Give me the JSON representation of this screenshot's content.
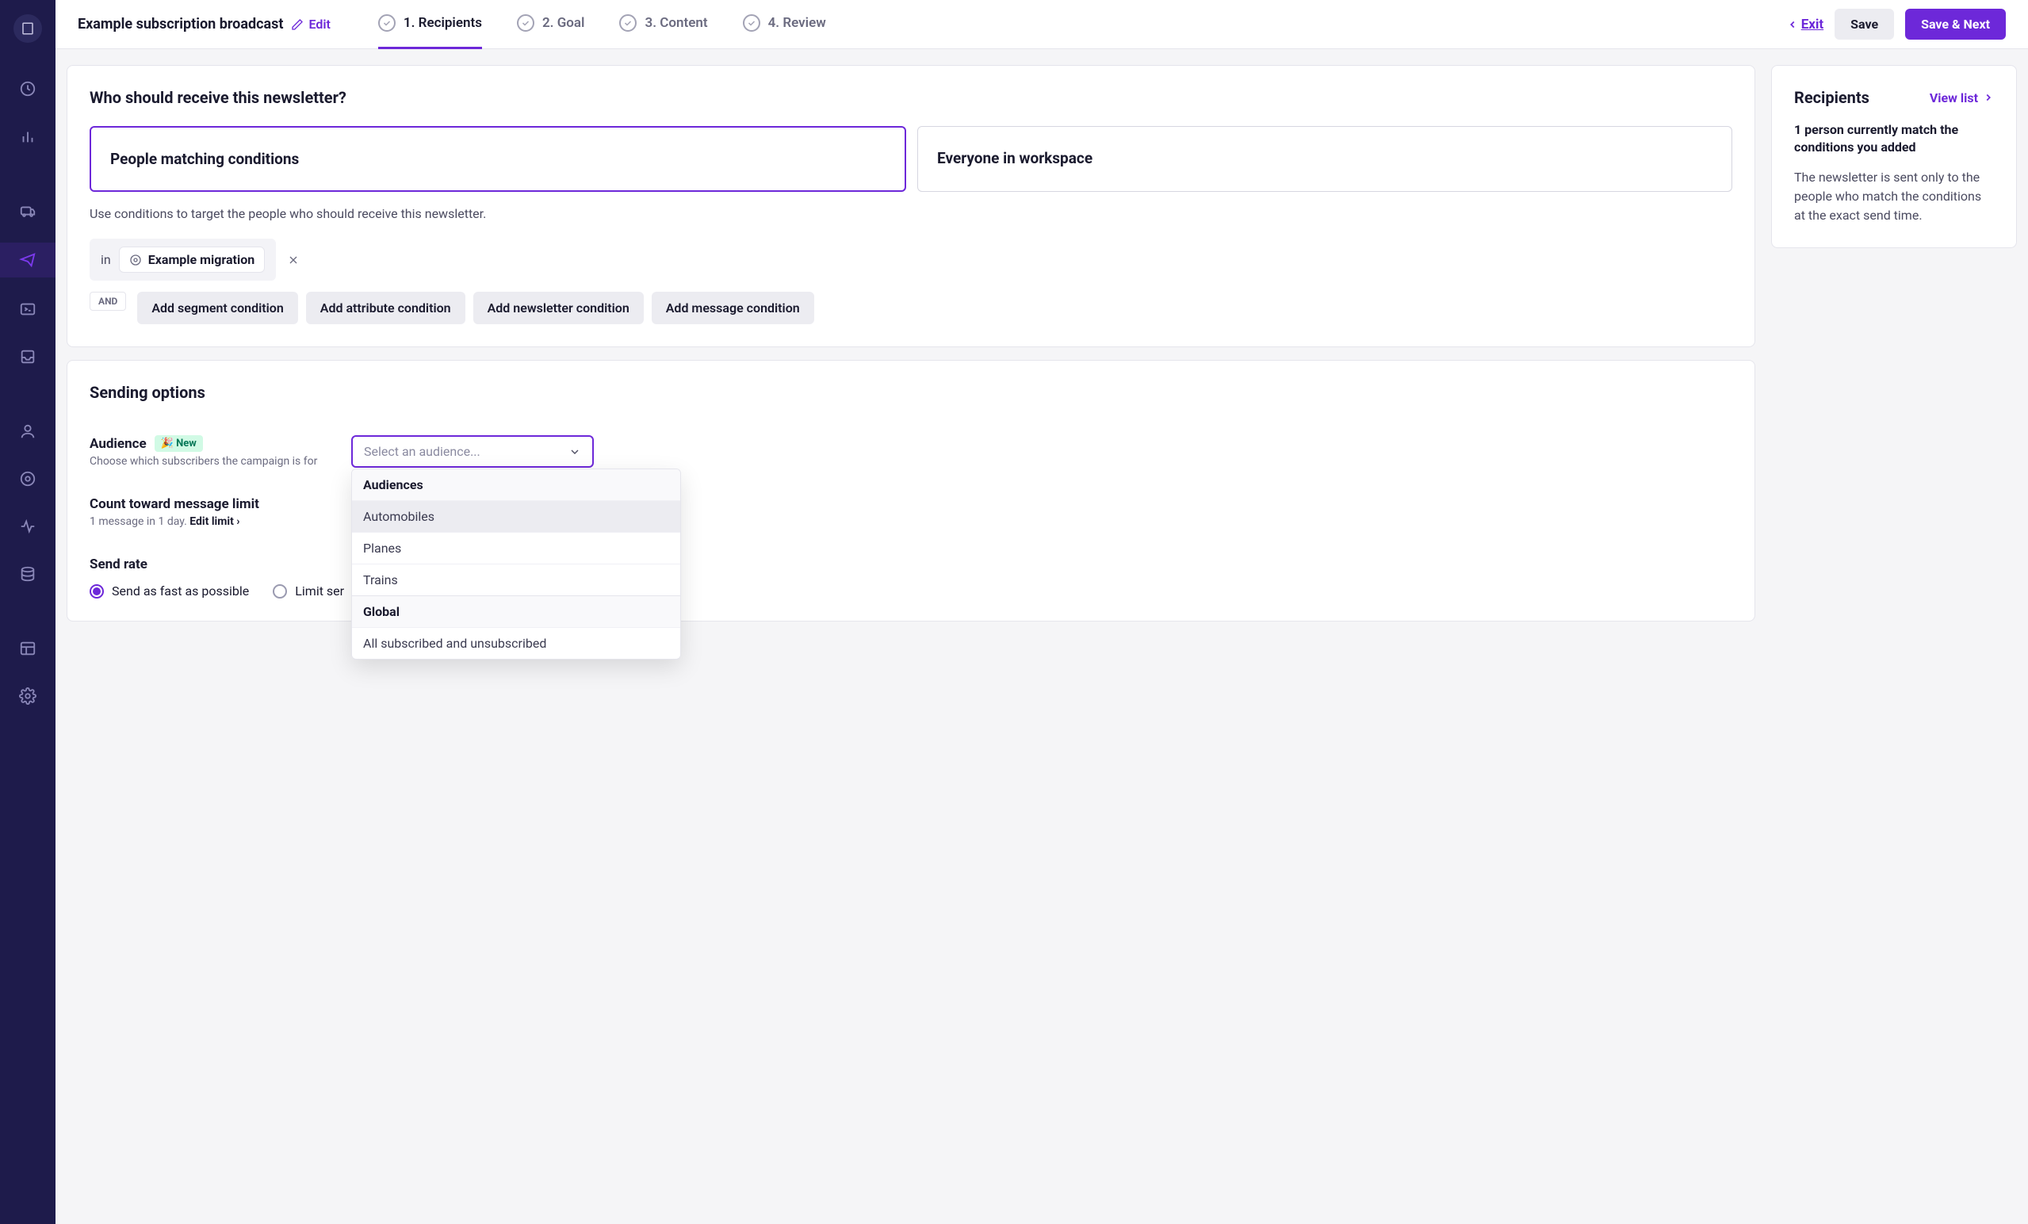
{
  "header": {
    "title": "Example subscription broadcast",
    "edit": "Edit",
    "exit": "Exit",
    "save": "Save",
    "save_next": "Save & Next"
  },
  "steps": [
    {
      "label": "1. Recipients",
      "active": true
    },
    {
      "label": "2. Goal"
    },
    {
      "label": "3. Content"
    },
    {
      "label": "4. Review"
    }
  ],
  "recipients": {
    "heading": "Who should receive this newsletter?",
    "choice_a": "People matching conditions",
    "choice_b": "Everyone in workspace",
    "helper": "Use conditions to target the people who should receive this newsletter.",
    "in_label": "in",
    "segment_name": "Example migration",
    "and": "AND",
    "btns": {
      "seg": "Add segment condition",
      "attr": "Add attribute condition",
      "news": "Add newsletter condition",
      "msg": "Add message condition"
    }
  },
  "side": {
    "title": "Recipients",
    "view_list": "View list",
    "strong": "1 person currently match the conditions you added",
    "text": "The newsletter is sent only to the people who match the conditions at the exact send time."
  },
  "sending": {
    "heading": "Sending options",
    "audience": {
      "label": "Audience",
      "new": "New",
      "sub": "Choose which subscribers the campaign is for",
      "placeholder": "Select an audience...",
      "group1": "Audiences",
      "items": [
        "Automobiles",
        "Planes",
        "Trains"
      ],
      "group2": "Global",
      "global_item": "All subscribed and unsubscribed"
    },
    "limit": {
      "label": "Count toward message limit",
      "sub_pre": "1 message in 1 day. ",
      "edit": "Edit limit"
    },
    "rate": {
      "label": "Send rate",
      "fast": "Send as fast as possible",
      "limit": "Limit ser"
    }
  }
}
